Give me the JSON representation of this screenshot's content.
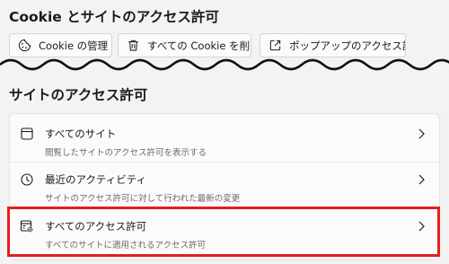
{
  "header": {
    "title": "Cookie とサイトのアクセス許可"
  },
  "buttons": {
    "manage_cookies": {
      "label": "Cookie の管理",
      "icon": "cookie-icon"
    },
    "delete_all_cookies": {
      "label": "すべての Cookie を削除",
      "icon": "trash-icon"
    },
    "popup_permissions": {
      "label": "ポップアップのアクセス許可",
      "icon": "open-external-icon"
    }
  },
  "section": {
    "title": "サイトのアクセス許可"
  },
  "list": {
    "items": [
      {
        "title": "すべてのサイト",
        "subtitle": "閲覧したサイトのアクセス許可を表示する",
        "icon": "window-icon"
      },
      {
        "title": "最近のアクティビティ",
        "subtitle": "サイトのアクセス許可に対して行われた最新の変更",
        "icon": "clock-icon"
      },
      {
        "title": "すべてのアクセス許可",
        "subtitle": "すべてのサイトに適用されるアクセス許可",
        "icon": "permissions-settings-icon",
        "highlighted": true
      }
    ]
  },
  "colors": {
    "background": "#f3f3f3",
    "card": "#fbfbfb",
    "highlight_border": "#e0201f",
    "secondary_text": "#6b6b6b"
  }
}
